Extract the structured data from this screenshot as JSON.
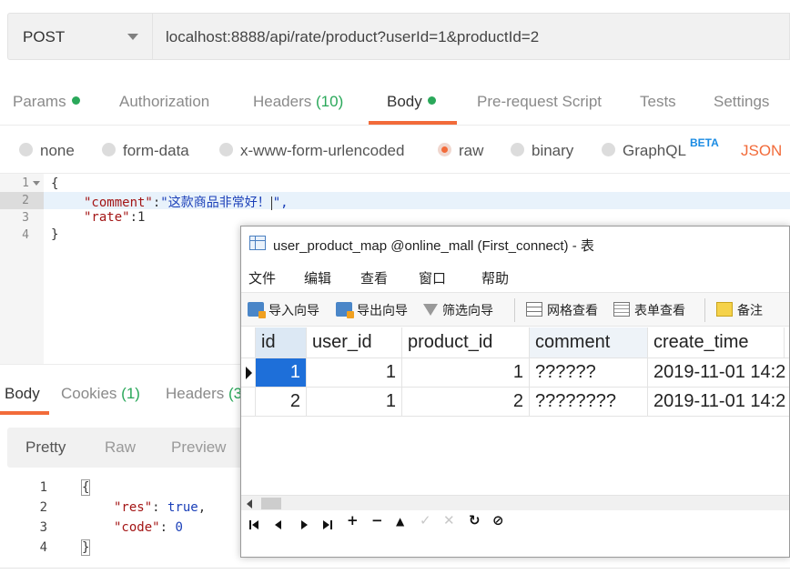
{
  "request": {
    "method": "POST",
    "url": "localhost:8888/api/rate/product?userId=1&productId=2"
  },
  "request_tabs": [
    {
      "label": "Params"
    },
    {
      "label": "Authorization"
    },
    {
      "label": "Headers",
      "count": "(10)"
    },
    {
      "label": "Body"
    },
    {
      "label": "Pre-request Script"
    },
    {
      "label": "Tests"
    },
    {
      "label": "Settings"
    }
  ],
  "body_types": {
    "none": "none",
    "form_data": "form-data",
    "urlencoded": "x-www-form-urlencoded",
    "raw": "raw",
    "binary": "binary",
    "graphql": "GraphQL",
    "beta": "BETA",
    "format": "JSON"
  },
  "request_body": {
    "line_numbers": [
      "1",
      "2",
      "3",
      "4"
    ],
    "open_brace": "{",
    "comment_key": "\"comment\"",
    "colon": ":",
    "comment_value": "\"这款商品非常好！",
    "comment_value_end": "\",",
    "rate_key": "\"rate\"",
    "rate_value": "1",
    "close_brace": "}"
  },
  "response_tabs": {
    "body": "Body",
    "cookies": "Cookies",
    "cookies_count": "(1)",
    "headers": "Headers",
    "headers_count": "(3"
  },
  "view_modes": {
    "pretty": "Pretty",
    "raw": "Raw",
    "preview": "Preview"
  },
  "response_body": {
    "line_numbers": [
      "1",
      "2",
      "3",
      "4"
    ],
    "open_brace": "{",
    "res_key": "\"res\"",
    "res_value": "true",
    "code_key": "\"code\"",
    "code_value": "0",
    "close_brace": "}",
    "colon": ": ",
    "comma": ","
  },
  "db_window": {
    "title": "user_product_map @online_mall (First_connect) - 表",
    "menu": [
      "文件",
      "编辑",
      "查看",
      "窗口",
      "帮助"
    ],
    "toolbar": {
      "import": "导入向导",
      "export": "导出向导",
      "filter": "筛选向导",
      "grid_view": "网格查看",
      "form_view": "表单查看",
      "note": "备注"
    },
    "columns": [
      "id",
      "user_id",
      "product_id",
      "comment",
      "create_time",
      "u"
    ],
    "rows": [
      {
        "id": "1",
        "user_id": "1",
        "product_id": "1",
        "comment": "??????",
        "create_time": "2019-11-01 14:2"
      },
      {
        "id": "2",
        "user_id": "1",
        "product_id": "2",
        "comment": "????????",
        "create_time": "2019-11-01 14:2"
      }
    ],
    "nav": {
      "add": "+",
      "delete": "−",
      "up": "▲",
      "apply": "✓",
      "discard": "✕",
      "refresh": "↻",
      "stop": "⊘"
    }
  },
  "colors": {
    "accent": "#f26b3a",
    "status_green": "#2aa85a",
    "selection_blue": "#1e6fd9"
  }
}
